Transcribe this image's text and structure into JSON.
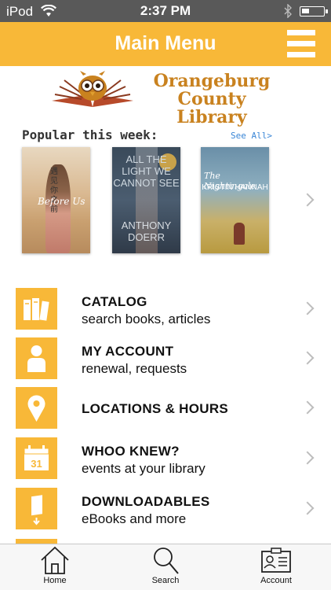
{
  "status_bar": {
    "carrier": "iPod",
    "time": "2:37 PM"
  },
  "nav": {
    "title": "Main Menu",
    "menu_icon": "hamburger-menu-icon"
  },
  "logo": {
    "line1": "Orangeburg",
    "line2": "County Library",
    "icon": "owl-on-open-book-logo"
  },
  "popular": {
    "heading": "Popular this week:",
    "see_all": "See All>",
    "books": [
      {
        "cover_text": "Before Us",
        "cjk": "遇见你之前"
      },
      {
        "cover_text": "ALL THE LIGHT WE CANNOT SEE",
        "author": "ANTHONY DOERR"
      },
      {
        "cover_text": "The Nightingale",
        "author": "KRISTIN HANNAH"
      }
    ]
  },
  "menu": [
    {
      "title": "CATALOG",
      "subtitle": "search books, articles",
      "icon": "books-icon"
    },
    {
      "title": "MY ACCOUNT",
      "subtitle": "renewal, requests",
      "icon": "person-icon"
    },
    {
      "title": "LOCATIONS & HOURS",
      "subtitle": "",
      "icon": "map-pin-icon"
    },
    {
      "title": "WHOO KNEW?",
      "subtitle": "events at your library",
      "icon": "calendar-icon",
      "calendar_day": "31"
    },
    {
      "title": "DOWNLOADABLES",
      "subtitle": "eBooks and more",
      "icon": "download-book-icon"
    }
  ],
  "tabs": [
    {
      "label": "Home",
      "icon": "home-icon"
    },
    {
      "label": "Search",
      "icon": "search-icon"
    },
    {
      "label": "Account",
      "icon": "account-card-icon"
    }
  ],
  "colors": {
    "accent": "#f8b838",
    "status_bar": "#595959",
    "link": "#3a86d6",
    "logo_text": "#c9821f"
  }
}
